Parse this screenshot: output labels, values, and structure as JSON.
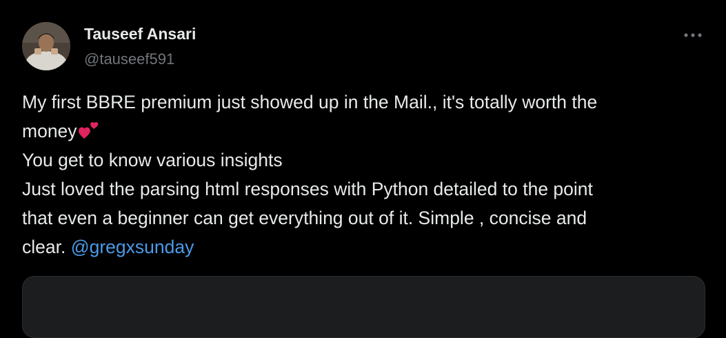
{
  "tweet": {
    "author": {
      "display_name": "Tauseef Ansari",
      "handle": "@tauseef591",
      "avatar_icon": "profile-photo"
    },
    "more_icon": "more-options-icon",
    "text": {
      "line1": "My first BBRE premium just showed up in the Mail., it's totally worth the",
      "line2": "money",
      "line2_emoji": "two-hearts-emoji",
      "line3": "You get to know various insights",
      "line4": "Just loved the parsing html responses with Python detailed to the point",
      "line5": "that even a beginner can get everything out of it. Simple , concise and",
      "line6_prefix": "clear. ",
      "mention": "@gregxsunday"
    },
    "colors": {
      "background": "#000000",
      "text": "#e7e9ea",
      "secondary_text": "#71767b",
      "link": "#4c9ae8",
      "heart": "#e0245e"
    }
  }
}
